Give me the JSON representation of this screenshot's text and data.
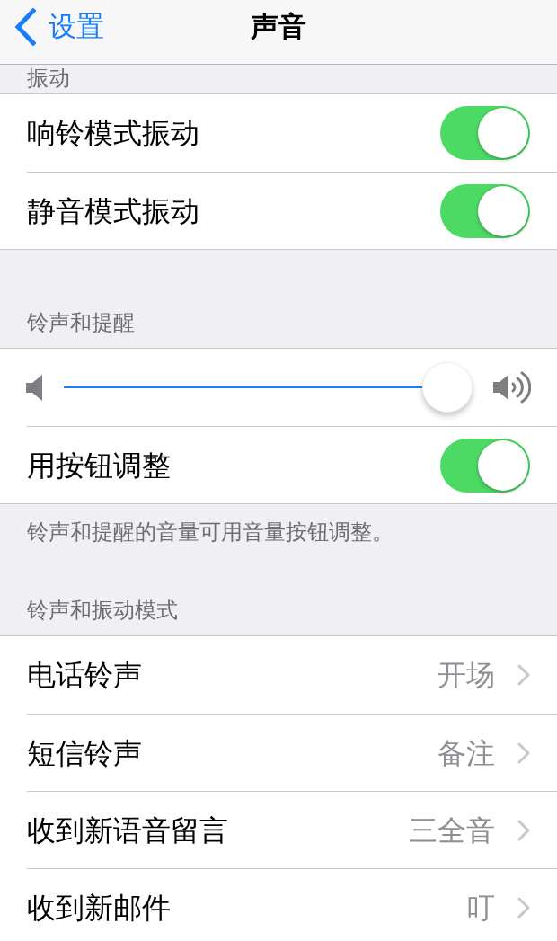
{
  "nav_bar": {
    "back_label": "设置",
    "title": "声音"
  },
  "sections": [
    {
      "header": "振动",
      "rows": [
        {
          "kind": "toggle",
          "label": "响铃模式振动",
          "on": true
        },
        {
          "kind": "toggle",
          "label": "静音模式振动",
          "on": true
        }
      ]
    },
    {
      "header": "铃声和提醒",
      "rows": [
        {
          "kind": "slider",
          "level": 1
        },
        {
          "kind": "toggle",
          "label": "用按钮调整",
          "on": true
        }
      ],
      "footer": "铃声和提醒的音量可用音量按钮调整。"
    },
    {
      "header": "铃声和振动模式",
      "rows": [
        {
          "kind": "link",
          "label": "电话铃声",
          "value": "开场"
        },
        {
          "kind": "link",
          "label": "短信铃声",
          "value": "备注"
        },
        {
          "kind": "link",
          "label": "收到新语音留言",
          "value": "三全音"
        },
        {
          "kind": "link",
          "label": "收到新邮件",
          "value": "叮"
        }
      ]
    }
  ]
}
